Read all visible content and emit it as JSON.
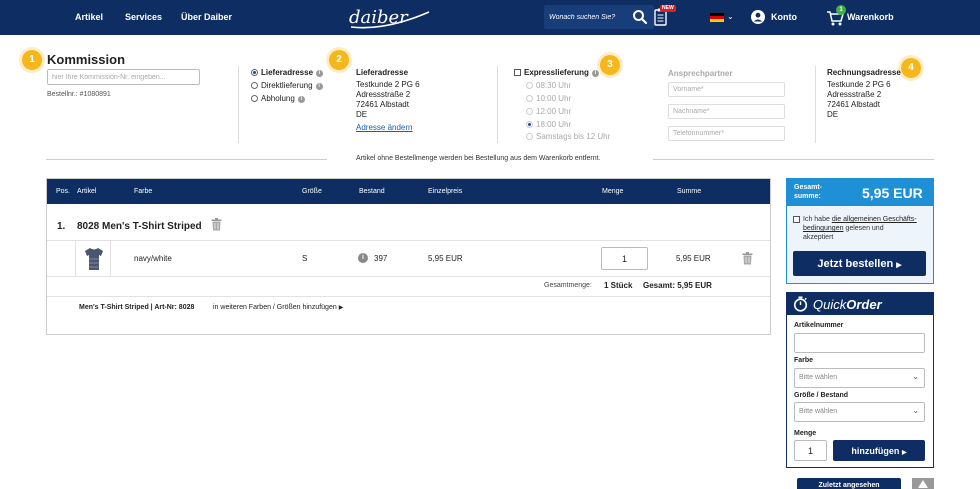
{
  "header": {
    "nav": [
      "Artikel",
      "Services",
      "Über Daiber"
    ],
    "logo_text": "daiber",
    "search_placeholder": "Wonach suchen Sie?",
    "new_badge": "NEW",
    "account_label": "Konto",
    "cart_count": "1",
    "cart_label": "Warenkorb"
  },
  "steps": [
    "1",
    "2",
    "3",
    "4"
  ],
  "commission": {
    "title": "Kommission",
    "placeholder": "hier Ihre Kommission-Nr. eingeben...",
    "order_no": "Bestellnr.: #1080891"
  },
  "delivery_options": [
    "Lieferadresse",
    "Direktlieferung",
    "Abholung"
  ],
  "delivery_address": {
    "title": "Lieferadresse",
    "lines": [
      "Testkunde 2 PG 6",
      "Adressstraße 2",
      "72461 Albstadt",
      "DE"
    ],
    "change_link": "Adresse ändern"
  },
  "express": {
    "label": "Expresslieferung",
    "times": [
      "08:30 Uhr",
      "10:00 Uhr",
      "12:00 Uhr",
      "18:00 Uhr",
      "Samstags bis 12 Uhr"
    ]
  },
  "contact": {
    "title": "Ansprechpartner",
    "fields": [
      "Vorname*",
      "Nachname*",
      "Telefonnummer*"
    ]
  },
  "billing_address": {
    "title": "Rechnungsadresse",
    "lines": [
      "Testkunde 2 PG 6",
      "Adressstraße 2",
      "72461 Albstadt",
      "DE"
    ]
  },
  "notice": "Artikel ohne Bestellmenge werden bei Bestellung aus dem Warenkorb entfernt.",
  "table": {
    "headers": [
      "Pos.",
      "Artikel",
      "Farbe",
      "Größe",
      "Bestand",
      "Einzelpreis",
      "Menge",
      "Summe"
    ],
    "group": {
      "pos": "1.",
      "title": "8028 Men's T-Shirt Striped"
    },
    "row": {
      "color": "navy/white",
      "size": "S",
      "stock": "397",
      "price": "5,95 EUR",
      "qty": "1",
      "sum": "5,95 EUR"
    },
    "total_label": "Gesamtmenge:",
    "total_qty": "1 Stück",
    "total_sum": "Gesamt: 5,95 EUR",
    "footer_title": "Men's T-Shirt Striped | Art-Nr: 8028",
    "footer_link": "in weiteren Farben / Größen hinzufügen"
  },
  "summary": {
    "label_line1": "Gesamt-",
    "label_line2": "summe:",
    "amount": "5,95 EUR",
    "terms_prefix": "Ich habe ",
    "terms_link1": "die allgemeinen Geschäfts-",
    "terms_link2": "bedingungen",
    "terms_suffix": " gelesen und",
    "terms_line3": "akzeptiert",
    "order_button": "Jetzt bestellen"
  },
  "quickorder": {
    "title_part1": "Quick",
    "title_part2": "Order",
    "article_label": "Artikelnummer",
    "color_label": "Farbe",
    "color_value": "Bitte wählen",
    "size_label": "Größe / Bestand",
    "size_value": "Bitte wählen",
    "qty_label": "Menge",
    "qty_value": "1",
    "add_button": "hinzufügen"
  },
  "bottom_button": "Zuletzt angesehen"
}
